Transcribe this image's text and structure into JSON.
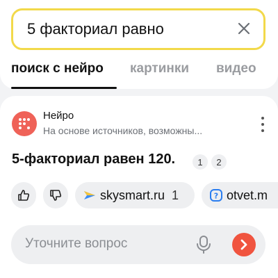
{
  "search": {
    "query": "5 факториал равно",
    "clear_icon": "close-icon"
  },
  "tabs": [
    {
      "label": "поиск с нейро",
      "active": true
    },
    {
      "label": "картинки",
      "active": false
    },
    {
      "label": "видео",
      "active": false
    }
  ],
  "answer_card": {
    "source_name": "Нейро",
    "source_description": "На основе источников, возможны...",
    "answer_text": "5-факториал равен 120.",
    "references": [
      "1",
      "2"
    ],
    "feedback": {
      "like_icon": "thumbs-up-icon",
      "dislike_icon": "thumbs-down-icon"
    },
    "sources": [
      {
        "label": "skysmart.ru",
        "count": "1",
        "icon": "skysmart-logo-icon"
      },
      {
        "label": "otvet.m",
        "icon": "otvet-logo-icon"
      }
    ]
  },
  "followup": {
    "placeholder": "Уточните вопрос",
    "mic_icon": "microphone-icon",
    "send_icon": "chevron-right-icon"
  },
  "colors": {
    "search_border": "#f2d94a",
    "accent_red": "#f0543f",
    "avatar_bg": "#ef6258",
    "background": "#f2f3f5"
  }
}
